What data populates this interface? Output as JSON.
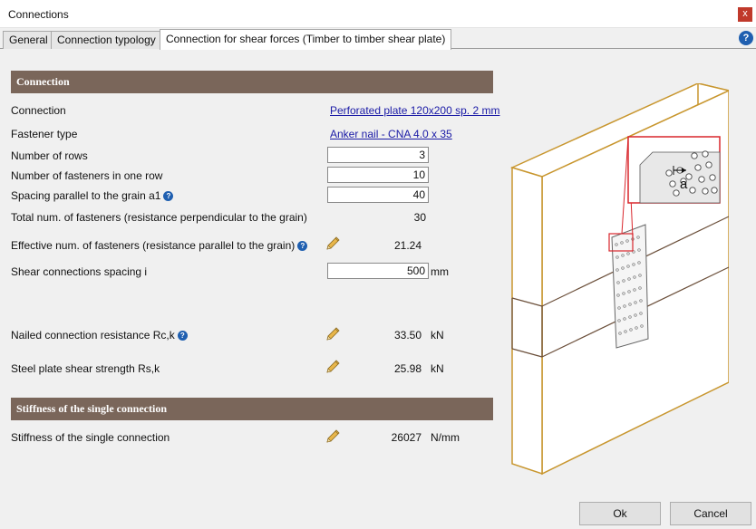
{
  "window": {
    "title": "Connections",
    "close_label": "x"
  },
  "tabs": [
    {
      "label": "General"
    },
    {
      "label": "Connection typology"
    },
    {
      "label": "Connection for shear forces (Timber to timber shear plate)"
    }
  ],
  "help_label": "?",
  "info_label": "?",
  "connection_section": {
    "header": "Connection",
    "connection": {
      "label": "Connection",
      "value": "Perforated plate 120x200 sp. 2 mm"
    },
    "fastener_type": {
      "label": "Fastener type",
      "value": "Anker nail - CNA 4.0 x 35"
    },
    "num_rows": {
      "label": "Number of rows",
      "value": "3"
    },
    "num_fasteners_row": {
      "label": "Number of fasteners in one row",
      "value": "10"
    },
    "spacing_a1": {
      "label": "Spacing parallel to the grain a1",
      "value": "40"
    },
    "total_fasteners": {
      "label": "Total num. of fasteners (resistance perpendicular to the grain)",
      "value": "30"
    },
    "effective_fasteners": {
      "label": "Effective num. of fasteners (resistance parallel to the grain)",
      "value": "21.24"
    },
    "shear_spacing": {
      "label": "Shear connections spacing i",
      "value": "500",
      "unit": "mm"
    },
    "nailed_resistance": {
      "label": "Nailed connection resistance  Rc,k",
      "value": "33.50",
      "unit": "kN"
    },
    "plate_strength": {
      "label": "Steel plate shear strength Rs,k",
      "value": "25.98",
      "unit": "kN"
    }
  },
  "stiffness_section": {
    "header": "Stiffness of the single connection",
    "stiffness": {
      "label": "Stiffness of the single connection",
      "value": "26027",
      "unit": "N/mm"
    }
  },
  "diagram": {
    "detail_label": "a"
  },
  "buttons": {
    "ok": "Ok",
    "cancel": "Cancel"
  },
  "colors": {
    "section_header": "#7a665a",
    "timber_edge": "#c8962e",
    "detail_red": "#d9262c",
    "link": "#1a1aa6"
  }
}
